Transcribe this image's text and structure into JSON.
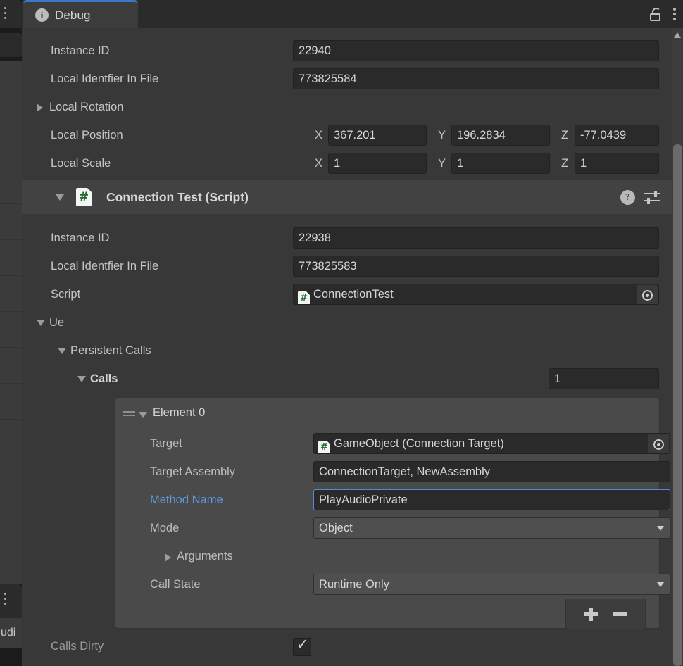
{
  "window": {
    "tab_label": "Debug",
    "tab_icon": "info-icon",
    "lock_icon": "unlocked-padlock-icon",
    "menu_icon": "kebab-menu-icon"
  },
  "neighbor_panel": {
    "menu_icon": "kebab-menu-icon",
    "bottom_menu_icon": "kebab-menu-icon",
    "tab_label_clipped": "udi"
  },
  "transform_section": {
    "rows": [
      {
        "label": "Instance ID",
        "value": "22940"
      },
      {
        "label": "Local Identfier In File",
        "value": "773825584"
      }
    ],
    "local_rotation": {
      "label": "Local Rotation",
      "foldout": "collapsed"
    },
    "local_position": {
      "label": "Local Position",
      "axes": [
        {
          "axis": "X",
          "value": "367.201"
        },
        {
          "axis": "Y",
          "value": "196.2834"
        },
        {
          "axis": "Z",
          "value": "-77.0439"
        }
      ]
    },
    "local_scale": {
      "label": "Local Scale",
      "axes": [
        {
          "axis": "X",
          "value": "1"
        },
        {
          "axis": "Y",
          "value": "1"
        },
        {
          "axis": "Z",
          "value": "1"
        }
      ]
    }
  },
  "component": {
    "title": "Connection Test (Script)",
    "script_icon": "csharp-script-icon",
    "foldout": "expanded",
    "help_icon": "help-icon",
    "preset_icon": "preset-sliders-icon",
    "menu_icon": "kebab-menu-icon",
    "rows": [
      {
        "label": "Instance ID",
        "value": "22938"
      },
      {
        "label": "Local Identfier In File",
        "value": "773825583"
      }
    ],
    "script_row": {
      "label": "Script",
      "value": "ConnectionTest",
      "picker_icon": "object-picker-icon"
    },
    "ue": {
      "label": "Ue"
    },
    "persistent_calls": {
      "label": "Persistent Calls"
    },
    "calls": {
      "label": "Calls",
      "size": "1"
    },
    "element": {
      "label": "Element 0",
      "drag_handle_icon": "drag-handle-icon",
      "target": {
        "label": "Target",
        "value": "GameObject (Connection Target)",
        "icon": "csharp-script-icon",
        "picker_icon": "object-picker-icon"
      },
      "target_assembly": {
        "label": "Target Assembly",
        "value": "ConnectionTarget, NewAssembly"
      },
      "method_name": {
        "label": "Method Name",
        "value": "PlayAudioPrivate",
        "highlight_color": "#4c8ed4",
        "label_color": "#5d9ae0"
      },
      "mode": {
        "label": "Mode",
        "value": "Object"
      },
      "arguments": {
        "label": "Arguments",
        "foldout": "collapsed"
      },
      "call_state": {
        "label": "Call State",
        "value": "Runtime Only"
      }
    },
    "list_footer": {
      "add_label": "+",
      "remove_label": "−"
    },
    "calls_dirty": {
      "label": "Calls Dirty",
      "checked": "✓"
    }
  },
  "scrollbar": {
    "up_arrow_icon": "scroll-up-arrow-icon"
  },
  "colors": {
    "background": "#383838",
    "field": "#2a2a2a",
    "header": "#424242",
    "accent_blue": "#3a79c6",
    "element_box": "#4a4a4a"
  }
}
